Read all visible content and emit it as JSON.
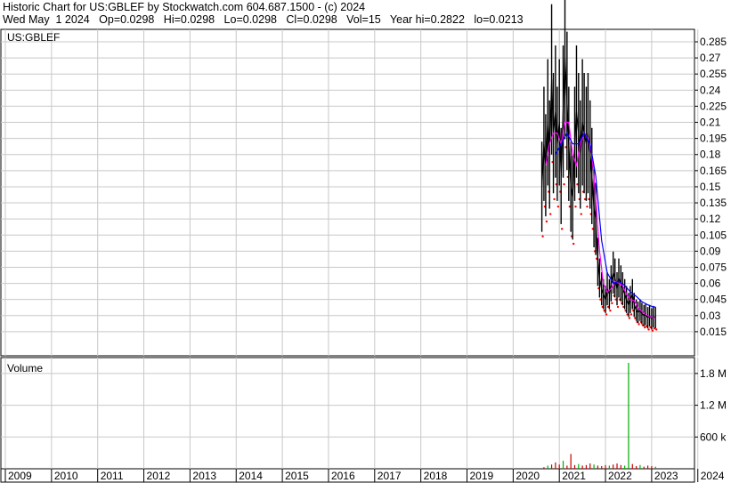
{
  "header": {
    "line1": "Historic Chart for US:GBLEF by Stockwatch.com 604.687.1500 - (c) 2024",
    "line2": "Wed May  1 2024   Op=0.0298   Hi=0.0298   Lo=0.0298   Cl=0.0298   Vol=15   Year hi=0.2822   lo=0.0213"
  },
  "chart_data": {
    "type": "line",
    "symbol_label": "US:GBLEF",
    "volume_label": "Volume",
    "price_ticks": [
      "0.285",
      "0.27",
      "0.255",
      "0.24",
      "0.225",
      "0.21",
      "0.195",
      "0.18",
      "0.165",
      "0.15",
      "0.135",
      "0.12",
      "0.105",
      "0.09",
      "0.075",
      "0.06",
      "0.045",
      "0.03",
      "0.015"
    ],
    "volume_ticks": [
      "1.8 M",
      "1.2 M",
      "600 k"
    ],
    "years": [
      "2009",
      "2010",
      "2011",
      "2012",
      "2013",
      "2014",
      "2015",
      "2016",
      "2017",
      "2018",
      "2019",
      "2020",
      "2021",
      "2022",
      "2023",
      "2024"
    ],
    "price_range": [
      0,
      0.295
    ],
    "volume_range": [
      0,
      2100000
    ],
    "grid": true,
    "colors": {
      "price": "#000000",
      "ma_short": "#ff00ff",
      "ma_long": "#0000ff",
      "low_points": "#ff0000",
      "volume": "#cc0000",
      "volume_alt": "#00aa00",
      "grid": "#c8c8c8"
    },
    "series": [
      {
        "role": "price_close",
        "points": [
          [
            "2020-08-15",
            0.15
          ],
          [
            "2020-09-01",
            0.19
          ],
          [
            "2020-09-15",
            0.17
          ],
          [
            "2020-10-01",
            0.21
          ],
          [
            "2020-10-15",
            0.18
          ],
          [
            "2020-11-01",
            0.25
          ],
          [
            "2020-11-15",
            0.2
          ],
          [
            "2020-12-01",
            0.22
          ],
          [
            "2020-12-15",
            0.19
          ],
          [
            "2021-01-01",
            0.21
          ],
          [
            "2021-01-15",
            0.16
          ],
          [
            "2021-02-01",
            0.22
          ],
          [
            "2021-02-15",
            0.27
          ],
          [
            "2021-03-01",
            0.23
          ],
          [
            "2021-03-15",
            0.19
          ],
          [
            "2021-04-01",
            0.15
          ],
          [
            "2021-04-15",
            0.14
          ],
          [
            "2021-05-01",
            0.19
          ],
          [
            "2021-05-15",
            0.22
          ],
          [
            "2021-06-01",
            0.2
          ],
          [
            "2021-06-15",
            0.18
          ],
          [
            "2021-07-01",
            0.21
          ],
          [
            "2021-07-15",
            0.2
          ],
          [
            "2021-08-01",
            0.19
          ],
          [
            "2021-08-15",
            0.2
          ],
          [
            "2021-09-01",
            0.18
          ],
          [
            "2021-09-15",
            0.16
          ],
          [
            "2021-10-01",
            0.13
          ],
          [
            "2021-10-15",
            0.12
          ],
          [
            "2021-11-01",
            0.08
          ],
          [
            "2021-11-15",
            0.065
          ],
          [
            "2021-12-01",
            0.055
          ],
          [
            "2021-12-15",
            0.05
          ],
          [
            "2022-01-01",
            0.045
          ],
          [
            "2022-01-15",
            0.055
          ],
          [
            "2022-02-01",
            0.05
          ],
          [
            "2022-02-15",
            0.06
          ],
          [
            "2022-03-01",
            0.07
          ],
          [
            "2022-03-15",
            0.065
          ],
          [
            "2022-04-01",
            0.055
          ],
          [
            "2022-04-15",
            0.065
          ],
          [
            "2022-05-01",
            0.06
          ],
          [
            "2022-05-15",
            0.055
          ],
          [
            "2022-06-01",
            0.05
          ],
          [
            "2022-06-15",
            0.045
          ],
          [
            "2022-07-01",
            0.04
          ],
          [
            "2022-07-15",
            0.045
          ],
          [
            "2022-08-01",
            0.05
          ],
          [
            "2022-08-15",
            0.04
          ],
          [
            "2022-09-01",
            0.035
          ],
          [
            "2022-09-15",
            0.033
          ],
          [
            "2022-10-01",
            0.035
          ],
          [
            "2022-10-15",
            0.032
          ],
          [
            "2022-11-01",
            0.03
          ],
          [
            "2022-11-15",
            0.031
          ],
          [
            "2022-12-01",
            0.028
          ],
          [
            "2022-12-15",
            0.03
          ],
          [
            "2023-01-01",
            0.027
          ],
          [
            "2023-01-15",
            0.029
          ],
          [
            "2023-02-01",
            0.028
          ]
        ]
      },
      {
        "role": "moving_average_short",
        "points": [
          [
            "2020-09-15",
            0.17
          ],
          [
            "2020-10-15",
            0.19
          ],
          [
            "2020-11-15",
            0.2
          ],
          [
            "2020-12-15",
            0.2
          ],
          [
            "2021-01-15",
            0.19
          ],
          [
            "2021-02-15",
            0.21
          ],
          [
            "2021-03-15",
            0.21
          ],
          [
            "2021-04-15",
            0.18
          ],
          [
            "2021-05-15",
            0.17
          ],
          [
            "2021-06-15",
            0.19
          ],
          [
            "2021-07-15",
            0.2
          ],
          [
            "2021-08-15",
            0.195
          ],
          [
            "2021-09-15",
            0.18
          ],
          [
            "2021-10-15",
            0.14
          ],
          [
            "2021-11-15",
            0.09
          ],
          [
            "2021-12-15",
            0.06
          ],
          [
            "2022-01-15",
            0.052
          ],
          [
            "2022-02-15",
            0.055
          ],
          [
            "2022-03-15",
            0.062
          ],
          [
            "2022-04-15",
            0.06
          ],
          [
            "2022-05-15",
            0.058
          ],
          [
            "2022-06-15",
            0.05
          ],
          [
            "2022-07-15",
            0.045
          ],
          [
            "2022-08-15",
            0.044
          ],
          [
            "2022-09-15",
            0.037
          ],
          [
            "2022-10-15",
            0.034
          ],
          [
            "2022-11-15",
            0.031
          ],
          [
            "2022-12-15",
            0.029
          ],
          [
            "2023-01-15",
            0.028
          ],
          [
            "2023-02-01",
            0.028
          ]
        ]
      },
      {
        "role": "moving_average_long",
        "points": [
          [
            "2020-12-01",
            0.18
          ],
          [
            "2021-01-15",
            0.19
          ],
          [
            "2021-03-01",
            0.2
          ],
          [
            "2021-04-15",
            0.19
          ],
          [
            "2021-06-01",
            0.19
          ],
          [
            "2021-07-15",
            0.2
          ],
          [
            "2021-09-01",
            0.19
          ],
          [
            "2021-10-15",
            0.16
          ],
          [
            "2021-12-01",
            0.1
          ],
          [
            "2022-01-15",
            0.07
          ],
          [
            "2022-03-01",
            0.06
          ],
          [
            "2022-04-15",
            0.062
          ],
          [
            "2022-06-01",
            0.058
          ],
          [
            "2022-07-15",
            0.052
          ],
          [
            "2022-09-01",
            0.048
          ],
          [
            "2022-10-15",
            0.043
          ],
          [
            "2022-12-01",
            0.04
          ],
          [
            "2023-01-15",
            0.038
          ],
          [
            "2023-02-01",
            0.038
          ]
        ]
      },
      {
        "role": "volume",
        "points": [
          [
            "2020-09-01",
            30000
          ],
          [
            "2020-10-01",
            60000
          ],
          [
            "2020-11-01",
            80000
          ],
          [
            "2020-12-01",
            120000
          ],
          [
            "2021-01-01",
            80000
          ],
          [
            "2021-02-01",
            150000
          ],
          [
            "2021-03-01",
            60000
          ],
          [
            "2021-04-01",
            280000
          ],
          [
            "2021-05-01",
            70000
          ],
          [
            "2021-06-01",
            90000
          ],
          [
            "2021-07-01",
            60000
          ],
          [
            "2021-08-01",
            70000
          ],
          [
            "2021-09-01",
            100000
          ],
          [
            "2021-10-01",
            80000
          ],
          [
            "2021-11-01",
            60000
          ],
          [
            "2021-12-01",
            50000
          ],
          [
            "2022-01-01",
            70000
          ],
          [
            "2022-02-01",
            60000
          ],
          [
            "2022-03-01",
            80000
          ],
          [
            "2022-04-01",
            100000
          ],
          [
            "2022-05-01",
            70000
          ],
          [
            "2022-06-01",
            60000
          ],
          [
            "2022-07-01",
            2000000
          ],
          [
            "2022-08-01",
            90000
          ],
          [
            "2022-09-01",
            50000
          ],
          [
            "2022-10-01",
            70000
          ],
          [
            "2022-11-01",
            40000
          ],
          [
            "2022-12-01",
            60000
          ],
          [
            "2023-01-01",
            50000
          ],
          [
            "2023-02-01",
            40000
          ]
        ]
      }
    ]
  }
}
